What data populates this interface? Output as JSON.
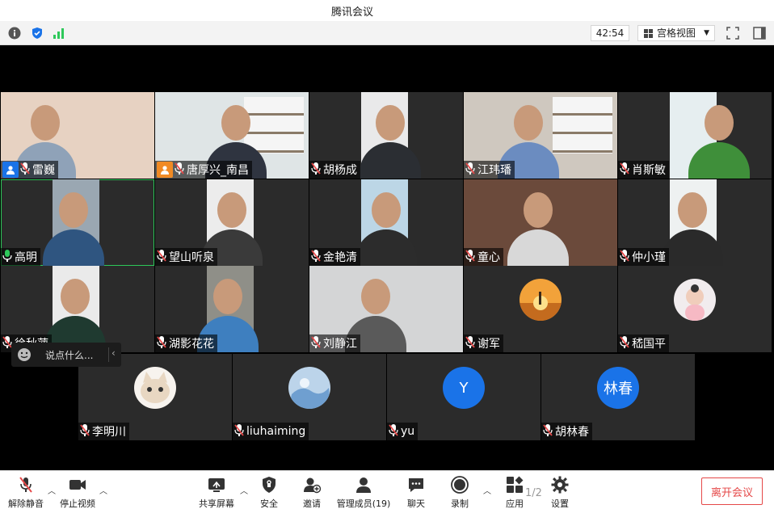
{
  "window": {
    "title": "腾讯会议"
  },
  "infobar": {
    "timer": "42:54",
    "view_label": "宫格视图",
    "icons": [
      "info-icon",
      "shield-icon",
      "signal-icon",
      "grid-icon",
      "fullscreen-icon",
      "sidebar-icon"
    ]
  },
  "participants": [
    {
      "name": "雷巍",
      "host": true,
      "mic": "muted"
    },
    {
      "name": "唐厚兴_南昌",
      "host": true,
      "mic": "muted"
    },
    {
      "name": "胡杨成",
      "host": false,
      "mic": "muted"
    },
    {
      "name": "江玮璠",
      "host": false,
      "mic": "muted"
    },
    {
      "name": "肖斯敏",
      "host": false,
      "mic": "muted"
    },
    {
      "name": "高明",
      "host": false,
      "mic": "speaking"
    },
    {
      "name": "望山听泉",
      "host": false,
      "mic": "muted"
    },
    {
      "name": "金艳清",
      "host": false,
      "mic": "muted"
    },
    {
      "name": "童心",
      "host": false,
      "mic": "muted"
    },
    {
      "name": "仲小瑾",
      "host": false,
      "mic": "muted"
    },
    {
      "name": "徐秋萍",
      "host": false,
      "mic": "muted"
    },
    {
      "name": "湖影花花",
      "host": false,
      "mic": "muted"
    },
    {
      "name": "刘静江",
      "host": false,
      "mic": "muted"
    },
    {
      "name": "谢军",
      "host": false,
      "mic": "muted"
    },
    {
      "name": "嵇国平",
      "host": false,
      "mic": "muted"
    },
    {
      "name": "李明川",
      "host": false,
      "mic": "muted"
    },
    {
      "name": "liuhaiming",
      "host": false,
      "mic": "muted"
    },
    {
      "name": "yu",
      "host": false,
      "mic": "muted",
      "avatar_letter": "Y"
    },
    {
      "name": "胡林春",
      "host": false,
      "mic": "muted",
      "avatar_letter": "林春"
    }
  ],
  "chat": {
    "placeholder": "说点什么..."
  },
  "toolbar": {
    "unmute": "解除静音",
    "stop_video": "停止视频",
    "share_screen": "共享屏幕",
    "security": "安全",
    "invite": "邀请",
    "manage_members": "管理成员(19)",
    "chat": "聊天",
    "record": "录制",
    "apps": "应用",
    "settings": "设置",
    "page": "1/2",
    "leave": "离开会议"
  },
  "colors": {
    "accent_blue": "#1a73e8",
    "speaking_green": "#2ec85a",
    "mute_red": "#e54848",
    "host_blue": "#1a73e8",
    "host_orange": "#f08a24"
  }
}
